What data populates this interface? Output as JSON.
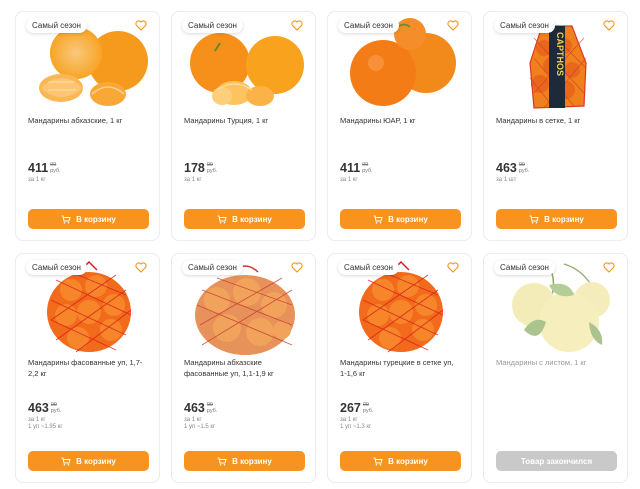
{
  "products": [
    {
      "badge": "Самый сезон",
      "title": "Мандарины абхазские, 1 кг",
      "price_main": "411",
      "price_kop": "99",
      "price_cur": "руб.",
      "unit1": "за 1 кг",
      "unit2": "",
      "button": "В корзину",
      "available": true,
      "image": "tangerines-peeled"
    },
    {
      "badge": "Самый сезон",
      "title": "Мандарины Турция, 1 кг",
      "price_main": "178",
      "price_kop": "99",
      "price_cur": "руб.",
      "unit1": "за 1 кг",
      "unit2": "",
      "button": "В корзину",
      "available": true,
      "image": "tangerines-slices"
    },
    {
      "badge": "Самый сезон",
      "title": "Мандарины ЮАР, 1 кг",
      "price_main": "411",
      "price_kop": "99",
      "price_cur": "руб.",
      "unit1": "за 1 кг",
      "unit2": "",
      "button": "В корзину",
      "available": true,
      "image": "tangerines-whole"
    },
    {
      "badge": "Самый сезон",
      "title": "Мандарины в сетке, 1 кг",
      "price_main": "463",
      "price_kop": "99",
      "price_cur": "руб.",
      "unit1": "за 1 шт",
      "unit2": "",
      "button": "В корзину",
      "available": true,
      "image": "tangerines-net-bag",
      "bag_text": "CAPTHOS"
    },
    {
      "badge": "Самый сезон",
      "title": "Мандарины фасованные уп, 1,7-2,2 кг",
      "price_main": "463",
      "price_kop": "99",
      "price_cur": "руб.",
      "unit1": "за 1 кг",
      "unit2": "1 уп ~1.95 кг",
      "button": "В корзину",
      "available": true,
      "image": "tangerines-red-net"
    },
    {
      "badge": "Самый сезон",
      "title": "Мандарины абхазские фасованные уп, 1,1-1,9 кг",
      "price_main": "463",
      "price_kop": "99",
      "price_cur": "руб.",
      "unit1": "за 1 кг",
      "unit2": "1 уп ~1.5 кг",
      "button": "В корзину",
      "available": true,
      "image": "tangerines-pale-net"
    },
    {
      "badge": "Самый сезон",
      "title": "Мандарины турецкие в сетке уп, 1-1,6 кг",
      "price_main": "267",
      "price_kop": "99",
      "price_cur": "руб.",
      "unit1": "за 1 кг",
      "unit2": "1 уп ~1.3 кг",
      "button": "В корзину",
      "available": true,
      "image": "tangerines-red-net"
    },
    {
      "badge": "Самый сезон",
      "title": "Мандарины с листом, 1 кг",
      "price_main": "",
      "price_kop": "",
      "price_cur": "",
      "unit1": "",
      "unit2": "",
      "button": "Товар закончился",
      "available": false,
      "image": "mandarins-with-leaves"
    }
  ],
  "colors": {
    "accent": "#f7931e",
    "disabled": "#c9c9c9",
    "heart": "#f7931e"
  }
}
